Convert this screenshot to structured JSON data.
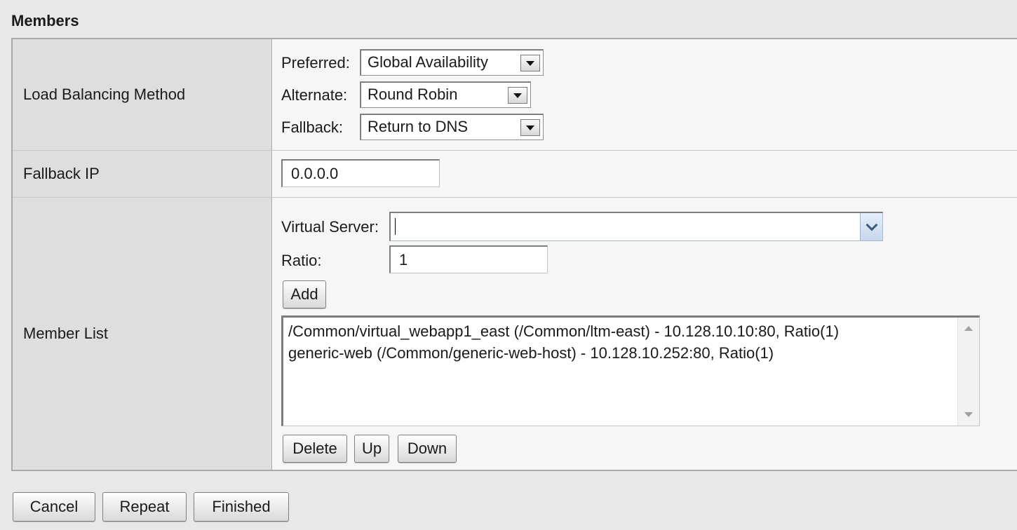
{
  "section": {
    "title": "Members"
  },
  "rows": {
    "load_balancing": {
      "label": "Load Balancing Method",
      "preferred_label": "Preferred:",
      "preferred_value": "Global Availability",
      "alternate_label": "Alternate:",
      "alternate_value": "Round Robin",
      "fallback_label": "Fallback:",
      "fallback_value": "Return to DNS"
    },
    "fallback_ip": {
      "label": "Fallback IP",
      "value": "0.0.0.0"
    },
    "member_list": {
      "label": "Member List",
      "virtual_server_label": "Virtual Server:",
      "virtual_server_value": "",
      "ratio_label": "Ratio:",
      "ratio_value": "1",
      "add_label": "Add",
      "members": [
        "/Common/virtual_webapp1_east (/Common/ltm-east) - 10.128.10.10:80, Ratio(1)",
        "generic-web (/Common/generic-web-host) - 10.128.10.252:80, Ratio(1)"
      ],
      "delete_label": "Delete",
      "up_label": "Up",
      "down_label": "Down"
    }
  },
  "actions": {
    "cancel_label": "Cancel",
    "repeat_label": "Repeat",
    "finished_label": "Finished"
  }
}
